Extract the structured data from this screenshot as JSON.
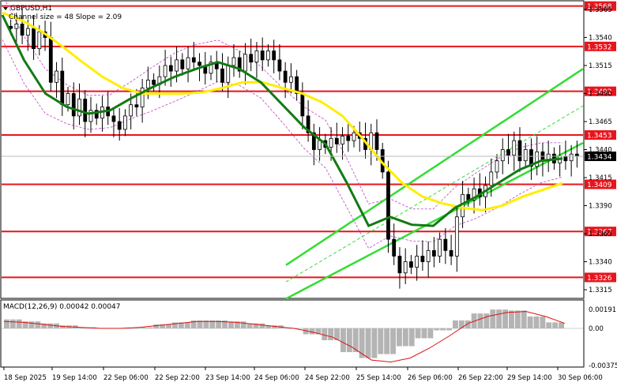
{
  "window": {
    "title": "GBPUSD,H1",
    "subtitle": "Channel size = 48 Slope = 2.09"
  },
  "chart_data": [
    {
      "type": "candlestick",
      "symbol": "GBPUSD",
      "timeframe": "H1",
      "ylim": [
        1.3308,
        1.3572
      ],
      "y_ticks": [
        1.3315,
        1.334,
        1.3365,
        1.339,
        1.3415,
        1.344,
        1.3465,
        1.349,
        1.3515,
        1.354,
        1.3565
      ],
      "y_tick_labels": [
        "1.3315",
        "1.3340",
        "1.3365",
        "1.3390",
        "1.3415",
        "1.3440",
        "1.3465",
        "1.3490",
        "1.3515",
        "1.3540",
        "1.3565"
      ],
      "x_tick_labels": [
        "18 Sep 2025",
        "19 Sep 14:00",
        "22 Sep 06:00",
        "22 Sep 22:00",
        "23 Sep 14:00",
        "24 Sep 06:00",
        "24 Sep 22:00",
        "25 Sep 14:00",
        "26 Sep 06:00",
        "26 Sep 22:00",
        "29 Sep 14:00",
        "30 Sep 06:00"
      ],
      "current_price": "1.3434",
      "horizontal_levels": [
        {
          "value": 1.3568,
          "label": "1.3568"
        },
        {
          "value": 1.3532,
          "label": "1.3532"
        },
        {
          "value": 1.3492,
          "label": "1.3492"
        },
        {
          "value": 1.3453,
          "label": "1.3453"
        },
        {
          "value": 1.3409,
          "label": "1.3409"
        },
        {
          "value": 1.3367,
          "label": "1.3367"
        },
        {
          "value": 1.3326,
          "label": "1.3326"
        }
      ],
      "colors": {
        "level_line": "#e8141c",
        "bull_candle": "#ffffff",
        "bear_candle": "#000000",
        "slow_ma": "#ffee00",
        "fast_ma": "#137a13",
        "channel": "#33dd33",
        "envelope": "#c040c0"
      },
      "channel": {
        "upper": [
          [
            1.3337,
            1.3512
          ]
        ],
        "lower": [
          [
            1.3307,
            1.3446
          ]
        ],
        "middle": [
          [
            1.3322,
            1.3479
          ]
        ]
      },
      "candles": [
        [
          1.355,
          1.3548
        ],
        [
          1.3548,
          1.3552
        ],
        [
          1.3552,
          1.3542
        ],
        [
          1.3542,
          1.3548
        ],
        [
          1.3548,
          1.353
        ],
        [
          1.353,
          1.3545
        ],
        [
          1.3545,
          1.354
        ],
        [
          1.354,
          1.35
        ],
        [
          1.35,
          1.351
        ],
        [
          1.351,
          1.348
        ],
        [
          1.348,
          1.349
        ],
        [
          1.349,
          1.347
        ],
        [
          1.347,
          1.3485
        ],
        [
          1.3485,
          1.3465
        ],
        [
          1.3465,
          1.3475
        ],
        [
          1.3475,
          1.3468
        ],
        [
          1.3468,
          1.3478
        ],
        [
          1.3478,
          1.347
        ],
        [
          1.347,
          1.3465
        ],
        [
          1.3465,
          1.3458
        ],
        [
          1.3458,
          1.347
        ],
        [
          1.347,
          1.348
        ],
        [
          1.348,
          1.3478
        ],
        [
          1.3478,
          1.3495
        ],
        [
          1.3495,
          1.3502
        ],
        [
          1.3502,
          1.3498
        ],
        [
          1.3498,
          1.3505
        ],
        [
          1.3505,
          1.3515
        ],
        [
          1.3515,
          1.351
        ],
        [
          1.351,
          1.352
        ],
        [
          1.352,
          1.3512
        ],
        [
          1.3512,
          1.3522
        ],
        [
          1.3522,
          1.3518
        ],
        [
          1.3518,
          1.3515
        ],
        [
          1.3515,
          1.3508
        ],
        [
          1.3508,
          1.3518
        ],
        [
          1.3518,
          1.3512
        ],
        [
          1.3512,
          1.35
        ],
        [
          1.35,
          1.3515
        ],
        [
          1.3515,
          1.3522
        ],
        [
          1.3522,
          1.351
        ],
        [
          1.351,
          1.3525
        ],
        [
          1.3525,
          1.3518
        ],
        [
          1.3518,
          1.3528
        ],
        [
          1.3528,
          1.352
        ],
        [
          1.352,
          1.3528
        ],
        [
          1.3528,
          1.352
        ],
        [
          1.352,
          1.351
        ],
        [
          1.351,
          1.35
        ],
        [
          1.35,
          1.3505
        ],
        [
          1.3505,
          1.349
        ],
        [
          1.349,
          1.347
        ],
        [
          1.347,
          1.3455
        ],
        [
          1.3455,
          1.344
        ],
        [
          1.344,
          1.3448
        ],
        [
          1.3448,
          1.3442
        ],
        [
          1.3442,
          1.345
        ],
        [
          1.345,
          1.3445
        ],
        [
          1.3445,
          1.3452
        ],
        [
          1.3452,
          1.3448
        ],
        [
          1.3448,
          1.3455
        ],
        [
          1.3455,
          1.345
        ],
        [
          1.345,
          1.344
        ],
        [
          1.344,
          1.3455
        ],
        [
          1.3455,
          1.344
        ],
        [
          1.344,
          1.342
        ],
        [
          1.342,
          1.336
        ],
        [
          1.336,
          1.3345
        ],
        [
          1.3345,
          1.333
        ],
        [
          1.333,
          1.334
        ],
        [
          1.334,
          1.3335
        ],
        [
          1.3335,
          1.3345
        ],
        [
          1.3345,
          1.334
        ],
        [
          1.334,
          1.335
        ],
        [
          1.335,
          1.3345
        ],
        [
          1.3345,
          1.336
        ],
        [
          1.336,
          1.335
        ],
        [
          1.335,
          1.3345
        ],
        [
          1.3345,
          1.338
        ],
        [
          1.338,
          1.34
        ],
        [
          1.34,
          1.3395
        ],
        [
          1.3395,
          1.3405
        ],
        [
          1.3405,
          1.3398
        ],
        [
          1.3398,
          1.3408
        ],
        [
          1.3408,
          1.342
        ],
        [
          1.342,
          1.343
        ],
        [
          1.343,
          1.344
        ],
        [
          1.344,
          1.3435
        ],
        [
          1.3435,
          1.3448
        ],
        [
          1.3448,
          1.343
        ],
        [
          1.343,
          1.344
        ],
        [
          1.344,
          1.3425
        ],
        [
          1.3425,
          1.3438
        ],
        [
          1.3438,
          1.343
        ],
        [
          1.343,
          1.3436
        ],
        [
          1.3436,
          1.3428
        ],
        [
          1.3428,
          1.3434
        ],
        [
          1.3434,
          1.343
        ],
        [
          1.343,
          1.3436
        ],
        [
          1.3436,
          1.3434
        ]
      ],
      "slow_ma": [
        1.3562,
        1.3555,
        1.3545,
        1.3532,
        1.3518,
        1.3505,
        1.3495,
        1.349,
        1.349,
        1.349,
        1.3491,
        1.3495,
        1.35,
        1.35,
        1.3495,
        1.349,
        1.3482,
        1.347,
        1.345,
        1.3428,
        1.341,
        1.3398,
        1.3392,
        1.3388,
        1.3386,
        1.339,
        1.3398,
        1.3404,
        1.341
      ],
      "fast_ma": [
        1.356,
        1.352,
        1.349,
        1.3478,
        1.3472,
        1.3475,
        1.3486,
        1.3496,
        1.3505,
        1.3512,
        1.3518,
        1.3512,
        1.35,
        1.348,
        1.346,
        1.3445,
        1.341,
        1.3372,
        1.338,
        1.3373,
        1.3372,
        1.3388,
        1.3398,
        1.341,
        1.3422,
        1.343,
        1.3432
      ]
    },
    {
      "type": "bar",
      "title": "MACD(12,26,9) 0.00042 0.00047",
      "ylim": [
        -0.00375,
        0.00191
      ],
      "y_tick_labels": [
        "0.00191",
        "0.00",
        "-0.00375"
      ],
      "series": [
        {
          "name": "MACD",
          "type": "bar",
          "values": [
            0.0009,
            0.0007,
            0.0005,
            0.0003,
            0.0001,
            0.0,
            0.0,
            0.0001,
            0.0004,
            0.0006,
            0.0008,
            0.0008,
            0.0007,
            0.0005,
            0.0003,
            0.0,
            -0.0006,
            -0.0012,
            -0.0024,
            -0.003,
            -0.0026,
            -0.0018,
            -0.001,
            -0.0002,
            0.0008,
            0.0015,
            0.0019,
            0.0018,
            0.0012,
            0.0006
          ]
        },
        {
          "name": "Signal",
          "type": "line",
          "values": [
            0.0007,
            0.0006,
            0.0004,
            0.0002,
            0.0001,
            0.0,
            0.0,
            0.0001,
            0.0003,
            0.0005,
            0.0007,
            0.0007,
            0.0006,
            0.0004,
            0.0002,
            0.0,
            -0.0004,
            -0.0009,
            -0.0019,
            -0.0032,
            -0.0034,
            -0.003,
            -0.002,
            -0.0008,
            0.0005,
            0.0012,
            0.0016,
            0.0017,
            0.0012,
            0.0005
          ]
        }
      ]
    }
  ]
}
